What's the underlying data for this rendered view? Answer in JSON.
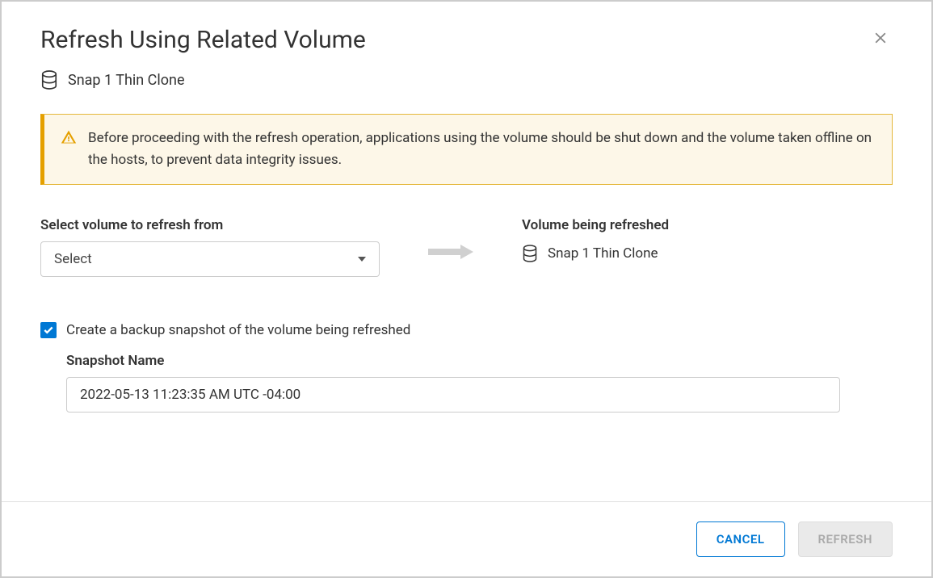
{
  "dialog": {
    "title": "Refresh Using Related Volume",
    "volumeName": "Snap 1 Thin Clone"
  },
  "warning": {
    "text": "Before proceeding with the refresh operation, applications using the volume should be shut down and the volume taken offline on the hosts, to prevent data integrity issues."
  },
  "source": {
    "label": "Select volume to refresh from",
    "selectedValue": "Select"
  },
  "target": {
    "label": "Volume being refreshed",
    "volumeName": "Snap 1 Thin Clone"
  },
  "backup": {
    "checkboxLabel": "Create a backup snapshot of the volume being refreshed",
    "checked": true,
    "snapshotLabel": "Snapshot Name",
    "snapshotName": "2022-05-13 11:23:35 AM UTC -04:00"
  },
  "footer": {
    "cancelLabel": "CANCEL",
    "refreshLabel": "REFRESH"
  }
}
